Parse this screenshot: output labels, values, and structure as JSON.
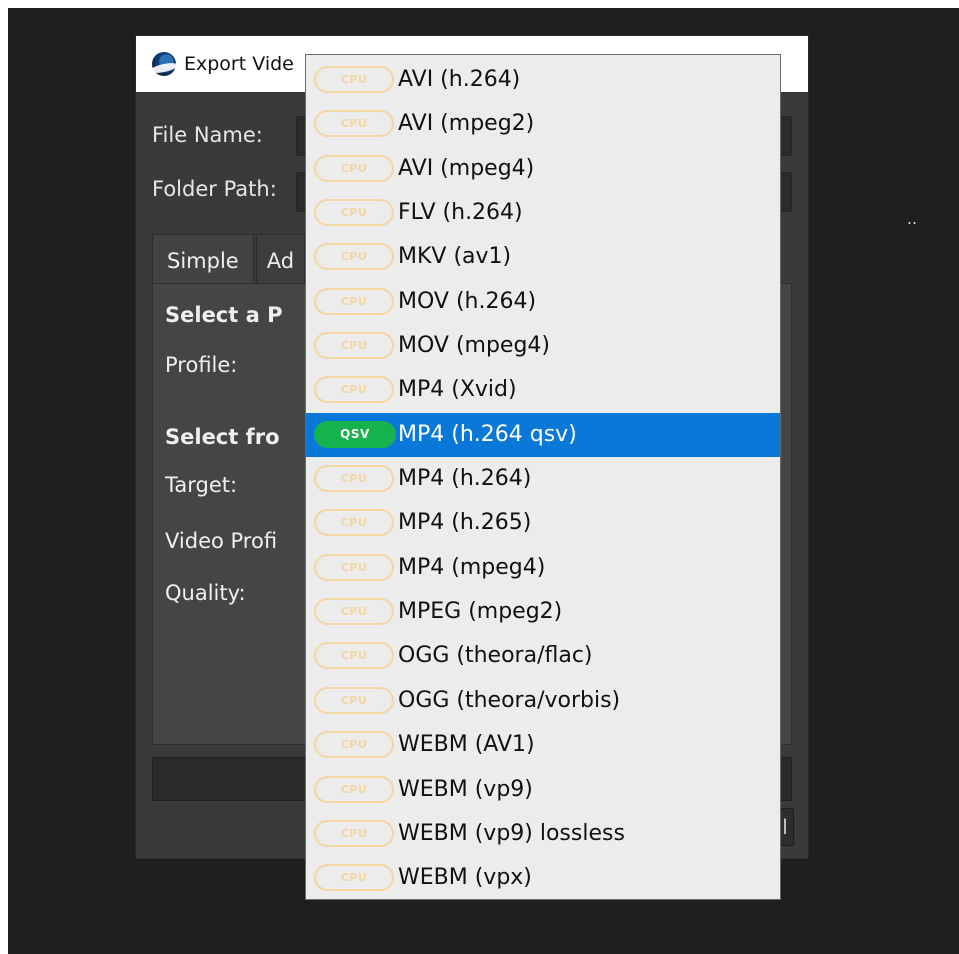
{
  "dialog": {
    "title": "Export Vide",
    "labels": {
      "file_name": "File Name:",
      "folder_path": "Folder Path:",
      "folder_path_button_partial": ".."
    },
    "tabs": [
      {
        "label": "Simple"
      },
      {
        "label": "Ad"
      }
    ],
    "simple": {
      "select_profile_heading_partial": "Select a P",
      "profile_label": "Profile:",
      "select_from_heading_partial": "Select fro",
      "target_label": "Target:",
      "video_profile_label_partial": "Video Profi",
      "quality_label": "Quality:"
    },
    "bottom_right_partial_button": "l"
  },
  "dropdown": {
    "options": [
      {
        "badge": "CPU",
        "badge_color": "#f3d6a1",
        "label": "AVI (h.264)",
        "selected": false
      },
      {
        "badge": "CPU",
        "badge_color": "#f3d6a1",
        "label": "AVI (mpeg2)",
        "selected": false
      },
      {
        "badge": "CPU",
        "badge_color": "#f3d6a1",
        "label": "AVI (mpeg4)",
        "selected": false
      },
      {
        "badge": "CPU",
        "badge_color": "#f3d6a1",
        "label": "FLV (h.264)",
        "selected": false
      },
      {
        "badge": "CPU",
        "badge_color": "#f3d6a1",
        "label": "MKV (av1)",
        "selected": false
      },
      {
        "badge": "CPU",
        "badge_color": "#f3d6a1",
        "label": "MOV (h.264)",
        "selected": false
      },
      {
        "badge": "CPU",
        "badge_color": "#f3d6a1",
        "label": "MOV (mpeg4)",
        "selected": false
      },
      {
        "badge": "CPU",
        "badge_color": "#f3d6a1",
        "label": "MP4 (Xvid)",
        "selected": false
      },
      {
        "badge": "QSV",
        "badge_color": "#15b24d",
        "label": "MP4 (h.264 qsv)",
        "selected": true
      },
      {
        "badge": "CPU",
        "badge_color": "#f3d6a1",
        "label": "MP4 (h.264)",
        "selected": false
      },
      {
        "badge": "CPU",
        "badge_color": "#f3d6a1",
        "label": "MP4 (h.265)",
        "selected": false
      },
      {
        "badge": "CPU",
        "badge_color": "#f3d6a1",
        "label": "MP4 (mpeg4)",
        "selected": false
      },
      {
        "badge": "CPU",
        "badge_color": "#f3d6a1",
        "label": "MPEG (mpeg2)",
        "selected": false
      },
      {
        "badge": "CPU",
        "badge_color": "#f3d6a1",
        "label": "OGG (theora/flac)",
        "selected": false
      },
      {
        "badge": "CPU",
        "badge_color": "#f3d6a1",
        "label": "OGG (theora/vorbis)",
        "selected": false
      },
      {
        "badge": "CPU",
        "badge_color": "#f3d6a1",
        "label": "WEBM (AV1)",
        "selected": false
      },
      {
        "badge": "CPU",
        "badge_color": "#f3d6a1",
        "label": "WEBM (vp9)",
        "selected": false
      },
      {
        "badge": "CPU",
        "badge_color": "#f3d6a1",
        "label": "WEBM (vp9) lossless",
        "selected": false
      },
      {
        "badge": "CPU",
        "badge_color": "#f3d6a1",
        "label": "WEBM (vpx)",
        "selected": false
      }
    ]
  },
  "colors": {
    "selection": "#0a78d8",
    "cpu_badge": "#f3d6a1",
    "qsv_badge": "#15b24d"
  }
}
